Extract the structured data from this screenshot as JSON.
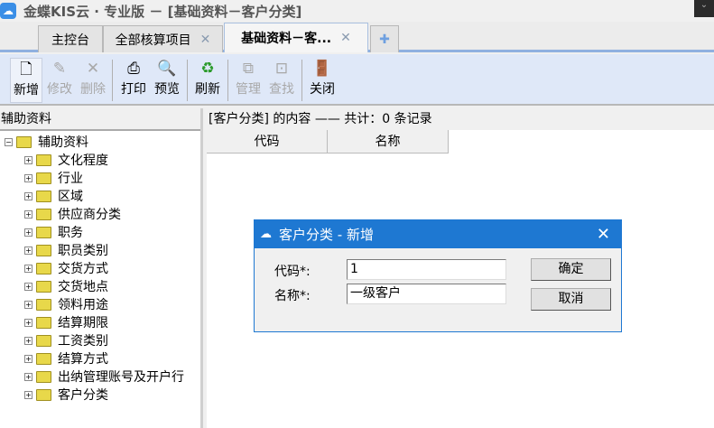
{
  "window": {
    "title": "金蝶KIS云 · 专业版 － [基础资料－客户分类]"
  },
  "tabs": [
    {
      "label": "主控台"
    },
    {
      "label": "全部核算项目",
      "close": "✕"
    },
    {
      "label": "基础资料－客...",
      "close": "✕"
    }
  ],
  "tab_add": "✚",
  "toolbar": {
    "new": "新增",
    "edit": "修改",
    "delete": "删除",
    "print": "打印",
    "preview": "预览",
    "refresh": "刷新",
    "manage": "管理",
    "find": "查找",
    "close": "关闭"
  },
  "left": {
    "header": "辅助资料",
    "root": "辅助资料",
    "items": [
      "文化程度",
      "行业",
      "区域",
      "供应商分类",
      "职务",
      "职员类别",
      "交货方式",
      "交货地点",
      "领料用途",
      "结算期限",
      "工资类别",
      "结算方式",
      "出纳管理账号及开户行",
      "客户分类"
    ]
  },
  "right": {
    "header": "[客户分类] 的内容 —— 共计：0 条记录",
    "columns": [
      "代码",
      "名称"
    ]
  },
  "dialog": {
    "title": "客户分类 - 新增",
    "code_label": "代码*:",
    "code_value": "1",
    "name_label": "名称*:",
    "name_value": "一级客户",
    "ok": "确定",
    "cancel": "取消"
  }
}
